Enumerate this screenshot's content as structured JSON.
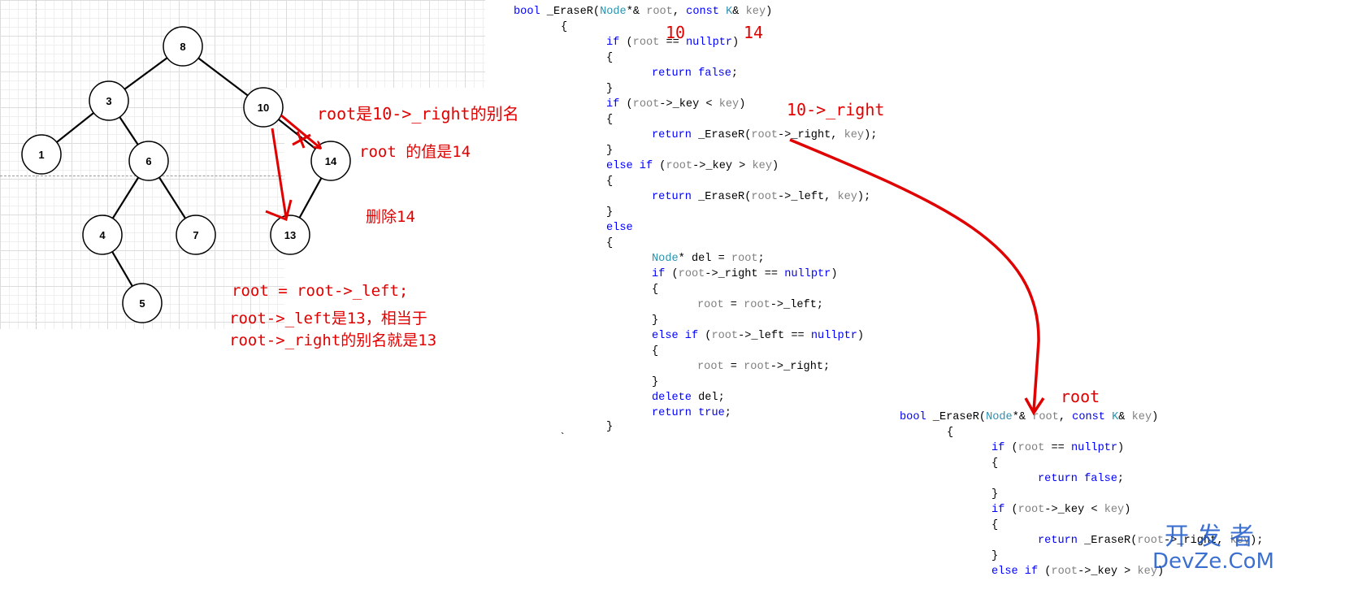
{
  "tree": {
    "nodes": [
      {
        "id": "8",
        "label": "8"
      },
      {
        "id": "3",
        "label": "3"
      },
      {
        "id": "10",
        "label": "10"
      },
      {
        "id": "1",
        "label": "1"
      },
      {
        "id": "6",
        "label": "6"
      },
      {
        "id": "14",
        "label": "14"
      },
      {
        "id": "4",
        "label": "4"
      },
      {
        "id": "7",
        "label": "7"
      },
      {
        "id": "13",
        "label": "13"
      },
      {
        "id": "5",
        "label": "5"
      }
    ],
    "edges": [
      [
        "8",
        "3"
      ],
      [
        "8",
        "10"
      ],
      [
        "3",
        "1"
      ],
      [
        "3",
        "6"
      ],
      [
        "10",
        "14"
      ],
      [
        "6",
        "4"
      ],
      [
        "6",
        "7"
      ],
      [
        "14",
        "13"
      ],
      [
        "4",
        "5"
      ]
    ]
  },
  "annotations": {
    "root_alias": "root是10->_right的别名",
    "root_value": "root 的值是14",
    "delete_14": "删除14",
    "assign": "root = root->_left;",
    "explain_1": "root->_left是13，相当于",
    "explain_2": "root->_right的别名就是13",
    "val_10": "10",
    "val_14": "14",
    "right_label": "10->_right",
    "root_label": "root"
  },
  "code_top": {
    "l1": {
      "kw": "bool",
      "name": " _EraseR(",
      "type1": "Node",
      "amp": "*& ",
      "p1": "root",
      "comma": ", ",
      "kw2": "const",
      "sp": " ",
      "type2": "K",
      "amp2": "& ",
      "p2": "key",
      "close": ")"
    },
    "l2": "{",
    "l3": {
      "kw": "if",
      "rest1": " (",
      "v": "root",
      "rest2": " == ",
      "kw2": "nullptr",
      "rest3": ")"
    },
    "l4": "{",
    "l5": {
      "kw": "return",
      "sp": " ",
      "kw2": "false",
      "rest": ";"
    },
    "l6": "}",
    "l7": {
      "kw": "if",
      "rest1": " (",
      "v": "root",
      "rest2": "->_key < ",
      "v2": "key",
      "rest3": ")"
    },
    "l8": "{",
    "l9": {
      "kw": "return",
      "rest1": " _EraseR(",
      "v": "root",
      "rest2": "->_right, ",
      "v2": "key",
      "rest3": ");"
    },
    "l10": "}",
    "l11": {
      "kw": "else if",
      "rest1": " (",
      "v": "root",
      "rest2": "->_key > ",
      "v2": "key",
      "rest3": ")"
    },
    "l12": "{",
    "l13": {
      "kw": "return",
      "rest1": " _EraseR(",
      "v": "root",
      "rest2": "->_left, ",
      "v2": "key",
      "rest3": ");"
    },
    "l14": "}",
    "l15": "else",
    "l16": "{",
    "l17": {
      "t": "Node",
      "rest1": "* del = ",
      "v": "root",
      "rest2": ";"
    },
    "l18": {
      "kw": "if",
      "rest1": " (",
      "v": "root",
      "rest2": "->_right == ",
      "kw2": "nullptr",
      "rest3": ")"
    },
    "l19": "{",
    "l20": {
      "v": "root",
      "rest1": " = ",
      "v2": "root",
      "rest2": "->_left;"
    },
    "l21": "}",
    "l22": {
      "kw": "else if",
      "rest1": " (",
      "v": "root",
      "rest2": "->_left == ",
      "kw2": "nullptr",
      "rest3": ")"
    },
    "l23": "{",
    "l24": {
      "v": "root",
      "rest1": " = ",
      "v2": "root",
      "rest2": "->_right;"
    },
    "l25": "}",
    "l26": {
      "kw": "delete",
      "rest": " del;"
    },
    "l27": {
      "kw": "return",
      "sp": " ",
      "kw2": "true",
      "rest": ";"
    },
    "l28": "}",
    "l29": "`"
  },
  "code_bottom": {
    "l1": {
      "kw": "bool",
      "name": " _EraseR(",
      "type1": "Node",
      "amp": "*& ",
      "p1": "root",
      "comma": ", ",
      "kw2": "const",
      "sp": " ",
      "type2": "K",
      "amp2": "& ",
      "p2": "key",
      "close": ")"
    },
    "l2": "{",
    "l3": {
      "kw": "if",
      "rest1": " (",
      "v": "root",
      "rest2": " == ",
      "kw2": "nullptr",
      "rest3": ")"
    },
    "l4": "{",
    "l5": {
      "kw": "return",
      "sp": " ",
      "kw2": "false",
      "rest": ";"
    },
    "l6": "}",
    "l7": {
      "kw": "if",
      "rest1": " (",
      "v": "root",
      "rest2": "->_key < ",
      "v2": "key",
      "rest3": ")"
    },
    "l8": "{",
    "l9": {
      "kw": "return",
      "rest1": " _EraseR(",
      "v": "root",
      "rest2": "->_right, ",
      "v2": "key",
      "rest3": ");"
    },
    "l10": "}",
    "l11": {
      "kw": "else if",
      "rest1": " (",
      "v": "root",
      "rest2": "->_key > ",
      "v2": "key",
      "rest3": ")"
    }
  },
  "watermark": {
    "cn": "开发者",
    "en": "DevZe.CoM"
  },
  "colors": {
    "annotation": "#e00000",
    "keyword": "#0000ff",
    "type": "#2b91af",
    "param": "#808080",
    "watermark": "#1a56c8"
  }
}
